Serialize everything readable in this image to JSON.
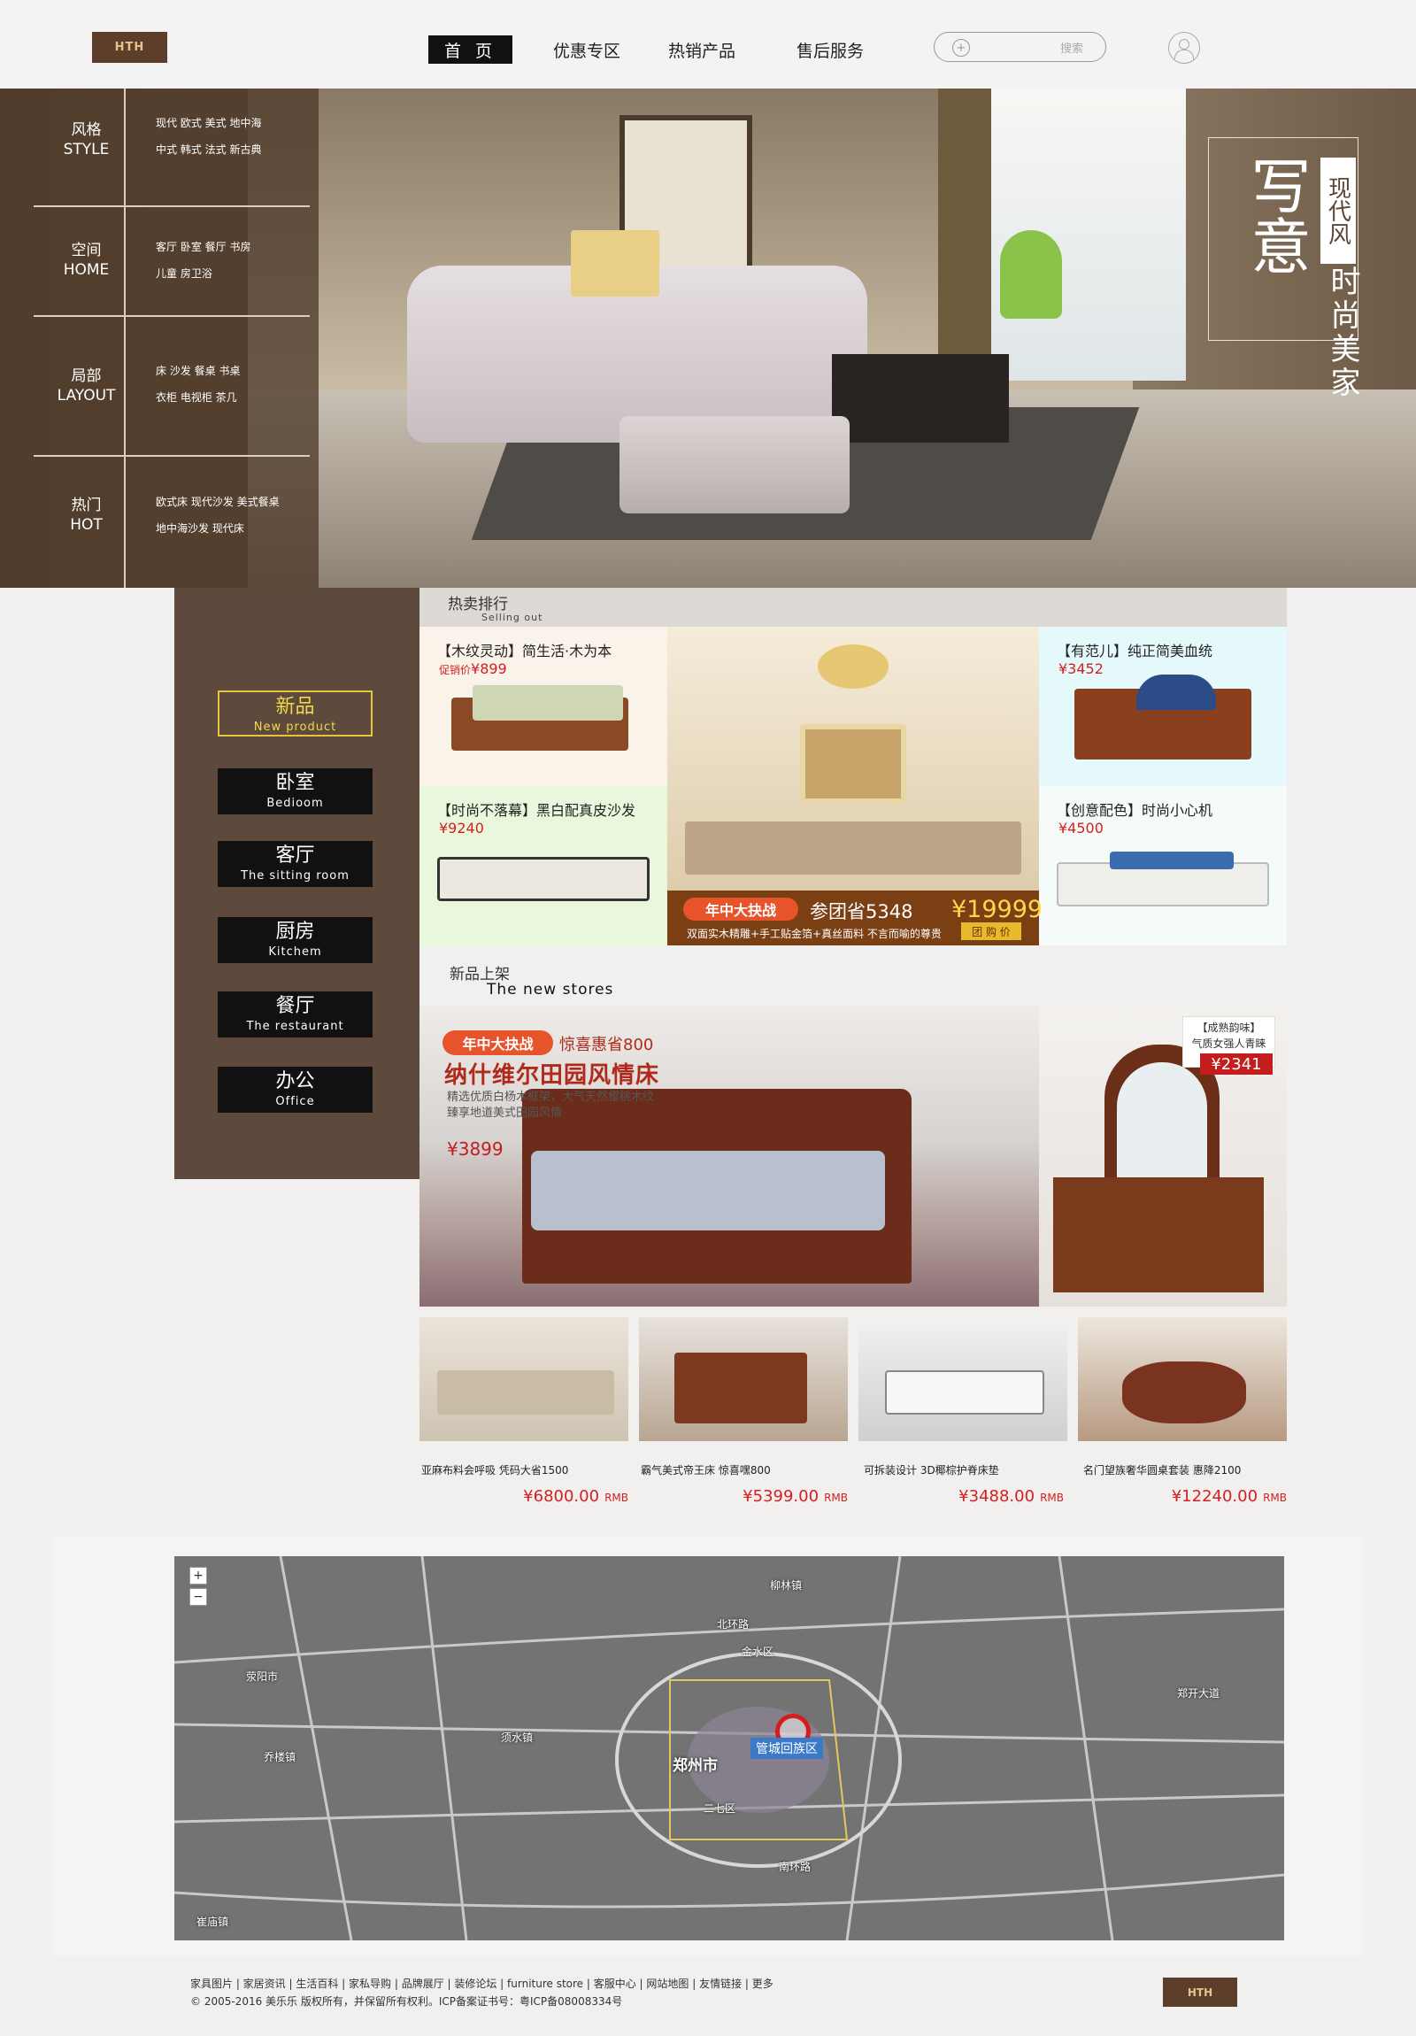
{
  "header": {
    "logo": "HTH",
    "nav": [
      "首 页",
      "优惠专区",
      "热销产品",
      "售后服务"
    ],
    "search_button": "搜索"
  },
  "hero": {
    "categories": [
      {
        "zh": "风格",
        "en": "STYLE",
        "line1": "现代  欧式  美式  地中海",
        "line2": "中式  韩式  法式  新古典"
      },
      {
        "zh": "空间",
        "en": "HOME",
        "line1": "客厅  卧室  餐厅  书房",
        "line2": "儿童      房卫浴"
      },
      {
        "zh": "局部",
        "en": "LAYOUT",
        "line1": "床  沙发  餐桌  书桌",
        "line2": "衣柜  电视柜  茶几"
      },
      {
        "zh": "热门",
        "en": "HOT",
        "line1": "欧式床  现代沙发  美式餐桌",
        "line2": "地中海沙发  现代床"
      }
    ],
    "slogan_big": "写意",
    "slogan_tag": "现代风",
    "slogan_small": "时尚美家"
  },
  "sidebar": {
    "items": [
      {
        "zh": "新品",
        "en": "New product"
      },
      {
        "zh": "卧室",
        "en": "Bedioom"
      },
      {
        "zh": "客厅",
        "en": "The sitting room"
      },
      {
        "zh": "厨房",
        "en": "Kitchem"
      },
      {
        "zh": "餐厅",
        "en": "The restaurant"
      },
      {
        "zh": "办公",
        "en": "Office"
      }
    ]
  },
  "hot": {
    "title": "热卖排行",
    "subtitle": "Selling out",
    "products": [
      {
        "title": "【木纹灵动】简生活·木为本",
        "price_label": "促销价",
        "price": "¥899"
      },
      {
        "title": "【时尚不落幕】黑白配真皮沙发",
        "price": "¥9240"
      },
      {
        "title": "【有范儿】纯正简美血统",
        "price": "¥3452"
      },
      {
        "title": "【创意配色】时尚小心机",
        "price": "¥4500"
      }
    ],
    "promo": {
      "badge": "年中大抉战",
      "save": "参团省5348",
      "price": "¥19999",
      "desc": "双面实木精雕+手工贴金箔+真丝面料  不言而喻的尊贵",
      "button": "团 购 价"
    }
  },
  "new": {
    "title": "新品上架",
    "subtitle": "The new stores",
    "banner": {
      "badge": "年中大抉战",
      "promo": "惊喜惠省800",
      "title": "纳什维尔田园风情床",
      "desc1": "精选优质白杨木框架，大气天然樱桃木纹",
      "desc2": "臻享地道美式田园风情",
      "price": "¥3899"
    },
    "side": {
      "tag1": "【成熟韵味】",
      "tag2": "气质女强人青睐",
      "price": "¥2341"
    },
    "grid": [
      {
        "name": "亚麻布料会呼吸 凭码大省1500",
        "price": "¥6800.00",
        "unit": "RMB"
      },
      {
        "name": "霸气美式帝王床 惊喜嘿800",
        "price": "¥5399.00",
        "unit": "RMB"
      },
      {
        "name": "可拆装设计 3D椰棕护脊床垫",
        "price": "¥3488.00",
        "unit": "RMB"
      },
      {
        "name": "名门望族奢华圆桌套装 惠降2100",
        "price": "¥12240.00",
        "unit": "RMB"
      }
    ]
  },
  "map": {
    "city": "郑州市",
    "district": "管城回族区",
    "places": [
      "荥阳市",
      "金水区",
      "二七区",
      "北环路",
      "南环路",
      "郑开大道",
      "柳林镇",
      "乔楼镇",
      "须水镇",
      "崔庙镇"
    ]
  },
  "footer": {
    "links": "家具图片 | 家居资讯 | 生活百科 | 家私导购 | 品牌展厅 | 装修论坛 | furniture store | 客服中心 | 网站地图 | 友情链接 | 更多",
    "copyright": "© 2005-2016 美乐乐 版权所有，并保留所有权利。ICP备案证书号：粤ICP备08008334号",
    "logo": "HTH"
  },
  "colors": {
    "brand_brown": "#5d4a3c",
    "price_red": "#d32020",
    "accent_yellow": "#e6c53a"
  }
}
